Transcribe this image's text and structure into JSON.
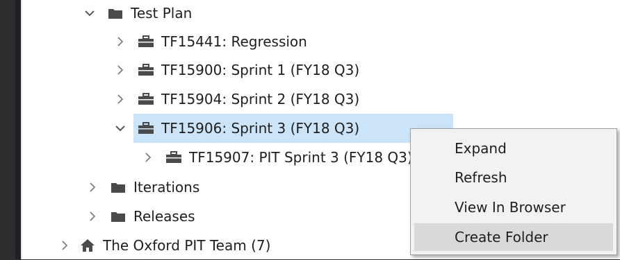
{
  "tree": {
    "items": [
      {
        "label": "Test Plan",
        "icon": "folder-icon",
        "expanded": true
      },
      {
        "label": "TF15441: Regression",
        "icon": "suite-icon",
        "expanded": false
      },
      {
        "label": "TF15900: Sprint 1 (FY18 Q3)",
        "icon": "suite-icon",
        "expanded": false
      },
      {
        "label": "TF15904: Sprint 2 (FY18 Q3)",
        "icon": "suite-icon",
        "expanded": false
      },
      {
        "label": "TF15906: Sprint 3 (FY18 Q3)",
        "icon": "suite-icon",
        "expanded": true,
        "selected": true
      },
      {
        "label": "TF15907: PIT Sprint 3 (FY18 Q3)",
        "icon": "suite-icon",
        "expanded": false
      },
      {
        "label": "Iterations",
        "icon": "folder-icon",
        "expanded": false
      },
      {
        "label": "Releases",
        "icon": "folder-icon",
        "expanded": false
      },
      {
        "label": "The Oxford PIT Team (7)",
        "icon": "home-icon",
        "expanded": false
      }
    ]
  },
  "context_menu": {
    "items": [
      {
        "label": "Expand"
      },
      {
        "label": "Refresh"
      },
      {
        "label": "View In Browser"
      },
      {
        "label": "Create Folder",
        "hover": true
      }
    ]
  },
  "colors": {
    "selection": "#cce4f7",
    "icon": "#4a4a4a",
    "menu_hover": "#d9d9d9",
    "frame": "#1f1f2a"
  }
}
